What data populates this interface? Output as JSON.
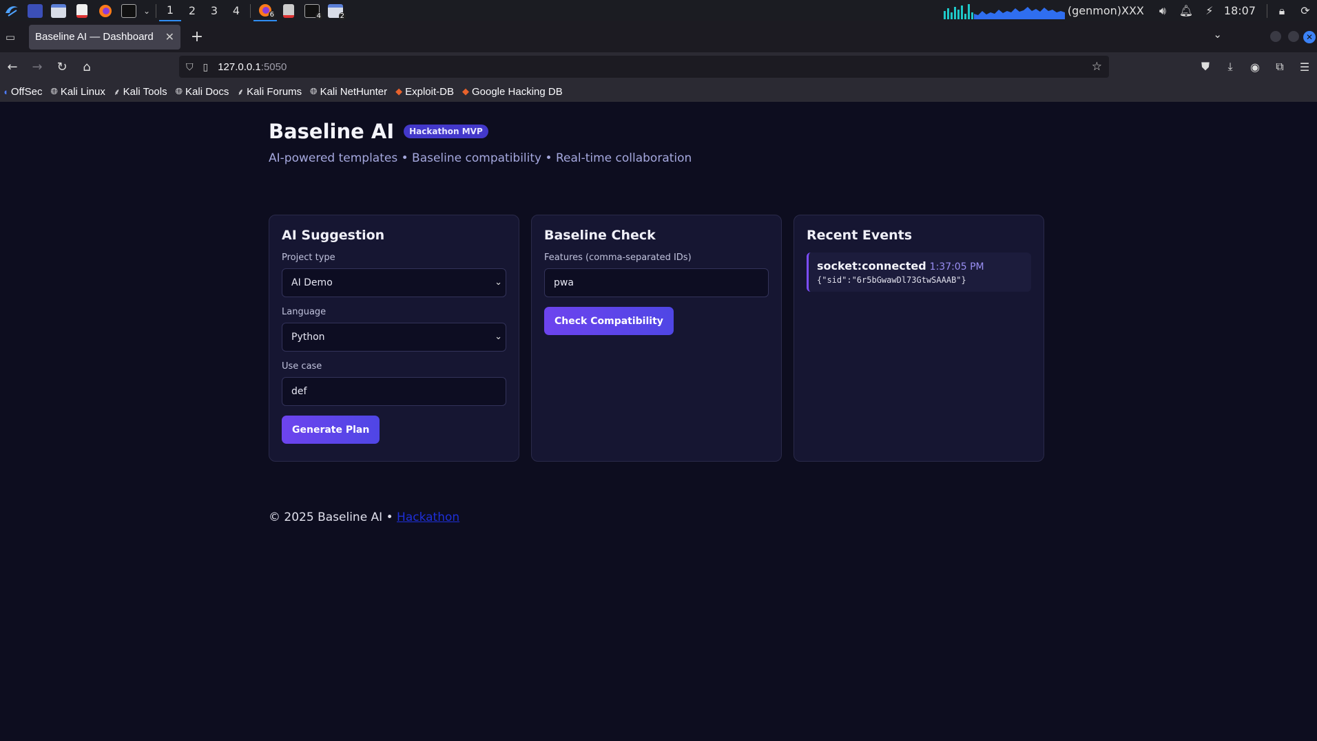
{
  "taskbar": {
    "workspaces": [
      "1",
      "2",
      "3",
      "4"
    ],
    "active_workspace": "1",
    "firefox_badge": "6",
    "terminal_badge": "4",
    "files_badge": "2",
    "genmon": "(genmon)XXX",
    "clock": "18:07"
  },
  "browser": {
    "tab_title": "Baseline AI — Dashboard",
    "url_host": "127.0.0.1",
    "url_port": ":5050",
    "bookmarks": [
      "OffSec",
      "Kali Linux",
      "Kali Tools",
      "Kali Docs",
      "Kali Forums",
      "Kali NetHunter",
      "Exploit-DB",
      "Google Hacking DB"
    ]
  },
  "header": {
    "title": "Baseline AI",
    "badge": "Hackathon MVP",
    "subtitle": "AI-powered templates • Baseline compatibility • Real-time collaboration"
  },
  "ai_suggestion": {
    "heading": "AI Suggestion",
    "project_type_label": "Project type",
    "project_type_value": "AI Demo",
    "language_label": "Language",
    "language_value": "Python",
    "use_case_label": "Use case",
    "use_case_value": "def",
    "button": "Generate Plan"
  },
  "baseline_check": {
    "heading": "Baseline Check",
    "features_label": "Features (comma-separated IDs)",
    "features_value": "pwa",
    "button": "Check Compatibility"
  },
  "recent_events": {
    "heading": "Recent Events",
    "events": [
      {
        "name": "socket:connected",
        "time": "1:37:05 PM",
        "payload": "{\"sid\":\"6r5bGwawDl73GtwSAAAB\"}"
      }
    ]
  },
  "footer": {
    "text": "© 2025 Baseline AI •",
    "link": "Hackathon"
  },
  "colors": {
    "page_bg": "#0d0d1f",
    "card_bg": "#161632",
    "accent": "#6d44ee",
    "badge_bg": "#4338ca",
    "link": "#1e2fd8"
  }
}
